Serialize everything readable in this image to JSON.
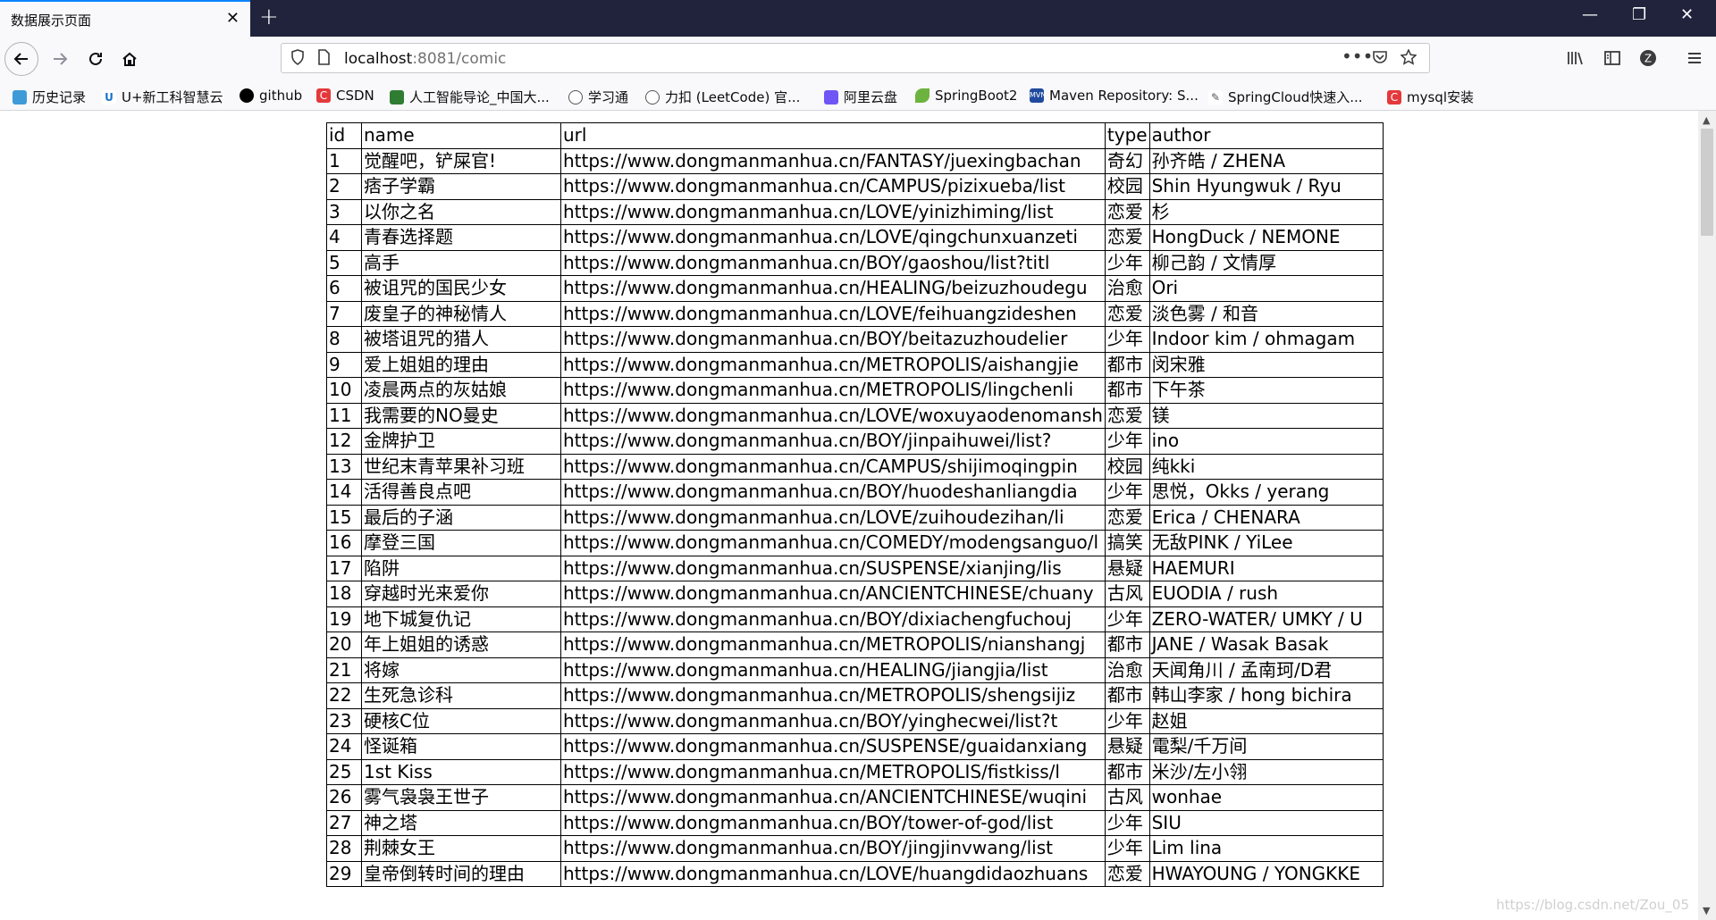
{
  "tab": {
    "title": "数据展示页面",
    "close": "✕",
    "new": "+"
  },
  "window": {
    "minimize": "—",
    "restore": "❐",
    "close": "✕"
  },
  "nav": {
    "url_host": "localhost",
    "url_rest": ":8081/comic"
  },
  "bookmarks": [
    {
      "label": "历史记录",
      "icon": "history-icon",
      "color": "#3e9bd8"
    },
    {
      "label": "U+新工科智慧云",
      "icon": "u-plus-icon",
      "color": "#1a73c8"
    },
    {
      "label": "github",
      "icon": "github-icon",
      "color": "#000000"
    },
    {
      "label": "CSDN",
      "icon": "csdn-icon",
      "color": "#e4393c"
    },
    {
      "label": "人工智能导论_中国大...",
      "icon": "mooc-icon",
      "color": "#2f7d32"
    },
    {
      "label": "学习通",
      "icon": "globe-icon",
      "color": "#555555"
    },
    {
      "label": "力扣 (LeetCode) 官...",
      "icon": "globe-icon",
      "color": "#555555"
    },
    {
      "label": "阿里云盘",
      "icon": "aliyun-drive-icon",
      "color": "#6f55f5"
    },
    {
      "label": "SpringBoot2",
      "icon": "spring-icon",
      "color": "#6db33f"
    },
    {
      "label": "Maven Repository: S...",
      "icon": "maven-icon",
      "color": "#1f4a9e"
    },
    {
      "label": "SpringCloud快速入...",
      "icon": "springcloud-icon",
      "color": "#555555"
    },
    {
      "label": "mysql安装",
      "icon": "csdn-icon",
      "color": "#e4393c"
    }
  ],
  "table": {
    "headers": [
      "id",
      "name",
      "url",
      "type",
      "author"
    ],
    "rows": [
      [
        "1",
        "觉醒吧，铲屎官!",
        "https://www.dongmanmanhua.cn/FANTASY/juexingbachan",
        "奇幻",
        "孙齐皓 / ZHENA"
      ],
      [
        "2",
        "痞子学霸",
        "https://www.dongmanmanhua.cn/CAMPUS/pizixueba/list",
        "校园",
        "Shin Hyungwuk / Ryu"
      ],
      [
        "3",
        "以你之名",
        "https://www.dongmanmanhua.cn/LOVE/yinizhiming/list",
        "恋爱",
        "杉"
      ],
      [
        "4",
        "青春选择题",
        "https://www.dongmanmanhua.cn/LOVE/qingchunxuanzeti",
        "恋爱",
        "HongDuck / NEMONE"
      ],
      [
        "5",
        "高手",
        "https://www.dongmanmanhua.cn/BOY/gaoshou/list?titl",
        "少年",
        "柳己韵 / 文情厚"
      ],
      [
        "6",
        "被诅咒的国民少女",
        "https://www.dongmanmanhua.cn/HEALING/beizuzhoudegu",
        "治愈",
        "Ori"
      ],
      [
        "7",
        "废皇子的神秘情人",
        "https://www.dongmanmanhua.cn/LOVE/feihuangzideshen",
        "恋爱",
        "淡色雾 / 和音"
      ],
      [
        "8",
        "被塔诅咒的猎人",
        "https://www.dongmanmanhua.cn/BOY/beitazuzhoudelier",
        "少年",
        "Indoor kim / ohmagam"
      ],
      [
        "9",
        "爱上姐姐的理由",
        "https://www.dongmanmanhua.cn/METROPOLIS/aishangjie",
        "都市",
        "闵宋雅"
      ],
      [
        "10",
        "凌晨两点的灰姑娘",
        "https://www.dongmanmanhua.cn/METROPOLIS/lingchenli",
        "都市",
        "下午茶"
      ],
      [
        "11",
        "我需要的NO曼史",
        "https://www.dongmanmanhua.cn/LOVE/woxuyaodenomansh",
        "恋爱",
        "镁"
      ],
      [
        "12",
        "金牌护卫",
        "https://www.dongmanmanhua.cn/BOY/jinpaihuwei/list?",
        "少年",
        "ino"
      ],
      [
        "13",
        "世纪末青苹果补习班",
        "https://www.dongmanmanhua.cn/CAMPUS/shijimoqingpin",
        "校园",
        "纯kki"
      ],
      [
        "14",
        "活得善良点吧",
        "https://www.dongmanmanhua.cn/BOY/huodeshanliangdia",
        "少年",
        "思悦，Okks / yerang"
      ],
      [
        "15",
        "最后的子涵",
        "https://www.dongmanmanhua.cn/LOVE/zuihoudezihan/li",
        "恋爱",
        "Erica / CHENARA"
      ],
      [
        "16",
        "摩登三国",
        "https://www.dongmanmanhua.cn/COMEDY/modengsanguo/l",
        "搞笑",
        "无敌PINK / YiLee"
      ],
      [
        "17",
        "陷阱",
        "https://www.dongmanmanhua.cn/SUSPENSE/xianjing/lis",
        "悬疑",
        "HAEMURI"
      ],
      [
        "18",
        "穿越时光来爱你",
        "https://www.dongmanmanhua.cn/ANCIENTCHINESE/chuany",
        "古风",
        "EUODIA / rush"
      ],
      [
        "19",
        "地下城复仇记",
        "https://www.dongmanmanhua.cn/BOY/dixiachengfuchouj",
        "少年",
        "ZERO-WATER/ UMKY / U"
      ],
      [
        "20",
        "年上姐姐的诱惑",
        "https://www.dongmanmanhua.cn/METROPOLIS/nianshangj",
        "都市",
        "JANE / Wasak Basak"
      ],
      [
        "21",
        "将嫁",
        "https://www.dongmanmanhua.cn/HEALING/jiangjia/list",
        "治愈",
        "天闻角川 / 孟南珂/D君"
      ],
      [
        "22",
        "生死急诊科",
        "https://www.dongmanmanhua.cn/METROPOLIS/shengsijiz",
        "都市",
        "韩山李家 / hong bichira"
      ],
      [
        "23",
        "硬核C位",
        "https://www.dongmanmanhua.cn/BOY/yinghecwei/list?t",
        "少年",
        "赵姐"
      ],
      [
        "24",
        "怪诞箱",
        "https://www.dongmanmanhua.cn/SUSPENSE/guaidanxiang",
        "悬疑",
        "電梨/千万间"
      ],
      [
        "25",
        "1st Kiss",
        "https://www.dongmanmanhua.cn/METROPOLIS/fistkiss/l",
        "都市",
        "米沙/左小翎"
      ],
      [
        "26",
        "雾气袅袅王世子",
        "https://www.dongmanmanhua.cn/ANCIENTCHINESE/wuqini",
        "古风",
        "wonhae"
      ],
      [
        "27",
        "神之塔",
        "https://www.dongmanmanhua.cn/BOY/tower-of-god/list",
        "少年",
        "SIU"
      ],
      [
        "28",
        "荆棘女王",
        "https://www.dongmanmanhua.cn/BOY/jingjinvwang/list",
        "少年",
        "Lim lina"
      ],
      [
        "29",
        "皇帝倒转时间的理由",
        "https://www.dongmanmanhua.cn/LOVE/huangdidaozhuans",
        "恋爱",
        "HWAYOUNG / YONGKKE"
      ]
    ]
  },
  "watermark": "https://blog.csdn.net/Zou_05"
}
